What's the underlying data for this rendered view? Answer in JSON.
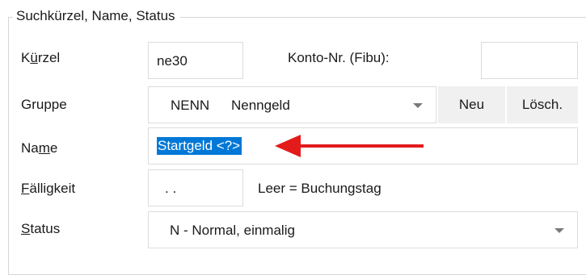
{
  "group": {
    "title": "Suchkürzel, Name, Status"
  },
  "kuerzel": {
    "label_prefix": "K",
    "label_accel": "ü",
    "label_suffix": "rzel",
    "value": "ne30"
  },
  "konto": {
    "label": "Konto-Nr. (Fibu):",
    "value": ""
  },
  "gruppe": {
    "label": "Gruppe",
    "code": "NENN",
    "name": "Nenngeld",
    "new_button": "Neu",
    "delete_button": "Lösch."
  },
  "name": {
    "label_prefix": "Na",
    "label_accel": "m",
    "label_suffix": "e",
    "value": "Startgeld <?>"
  },
  "faelligkeit": {
    "label_accel": "F",
    "label_suffix": "älligkeit",
    "value": " .  .",
    "hint": "Leer = Buchungstag"
  },
  "status": {
    "label_accel": "S",
    "label_suffix": "tatus",
    "value": "N - Normal, einmalig"
  },
  "colors": {
    "selection": "#0078d7",
    "annotation_arrow": "#e31b1b"
  },
  "icons": {
    "dropdown": "chevron-down-icon",
    "annotation": "red-arrow-icon"
  }
}
